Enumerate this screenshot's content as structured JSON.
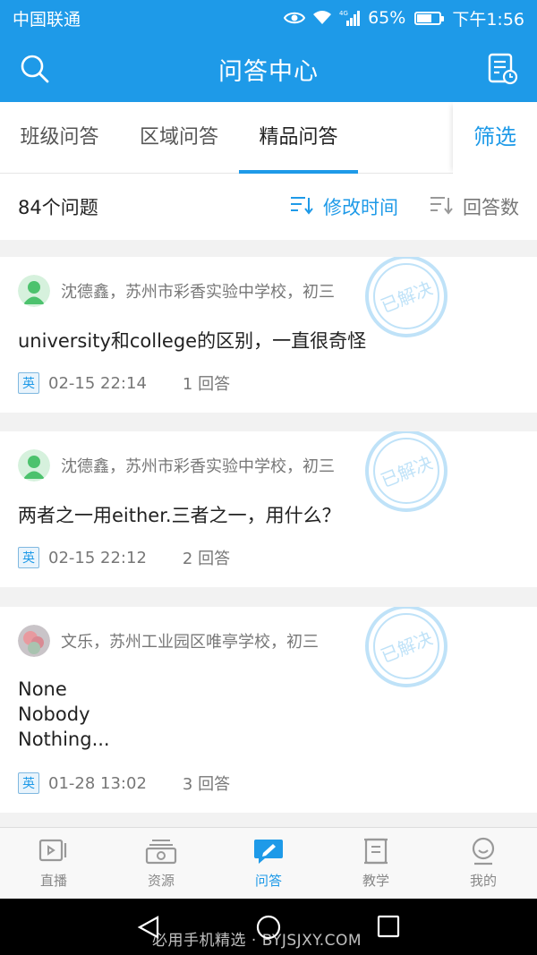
{
  "status_bar": {
    "carrier": "中国联通",
    "network": "4G",
    "battery": "65%",
    "battery_level": 0.65,
    "time": "下午1:56"
  },
  "app_bar": {
    "title": "问答中心",
    "left_icon": "search-icon",
    "right_icon": "report-clock-icon"
  },
  "tabs": [
    {
      "label": "班级问答",
      "active": false
    },
    {
      "label": "区域问答",
      "active": false
    },
    {
      "label": "精品问答",
      "active": true
    }
  ],
  "filter_label": "筛选",
  "sort_bar": {
    "count": "84个问题",
    "options": [
      {
        "label": "修改时间",
        "active": true
      },
      {
        "label": "回答数",
        "active": false
      }
    ]
  },
  "stamp_text": "已解决",
  "questions": [
    {
      "author_info": "沈德鑫，苏州市彩香实验中学校，初三",
      "question": "university和college的区别，一直很奇怪",
      "subject": "英",
      "time": "02-15 22:14",
      "answers": "1 回答",
      "avatar": "default-avatar",
      "solved": true
    },
    {
      "author_info": "沈德鑫，苏州市彩香实验中学校，初三",
      "question": "两者之一用either.三者之一，用什么？",
      "subject": "英",
      "time": "02-15 22:12",
      "answers": "2 回答",
      "avatar": "default-avatar",
      "solved": true
    },
    {
      "author_info": "文乐，苏州工业园区唯亭学校，初三",
      "question": "None\nNobody\nNothing...",
      "subject": "英",
      "time": "01-28 13:02",
      "answers": "3 回答",
      "avatar": "photo-avatar",
      "solved": true
    }
  ],
  "bottom_nav": [
    {
      "label": "直播",
      "icon": "live-icon",
      "active": false
    },
    {
      "label": "资源",
      "icon": "resources-icon",
      "active": false
    },
    {
      "label": "问答",
      "icon": "qa-icon",
      "active": true
    },
    {
      "label": "教学",
      "icon": "teaching-icon",
      "active": false
    },
    {
      "label": "我的",
      "icon": "profile-icon",
      "active": false
    }
  ],
  "watermark": "必用手机精选 · BYJSJXY.COM",
  "colors": {
    "primary": "#1e9ae8",
    "background": "#f2f2f2",
    "text": "#222222",
    "muted": "#777777"
  }
}
